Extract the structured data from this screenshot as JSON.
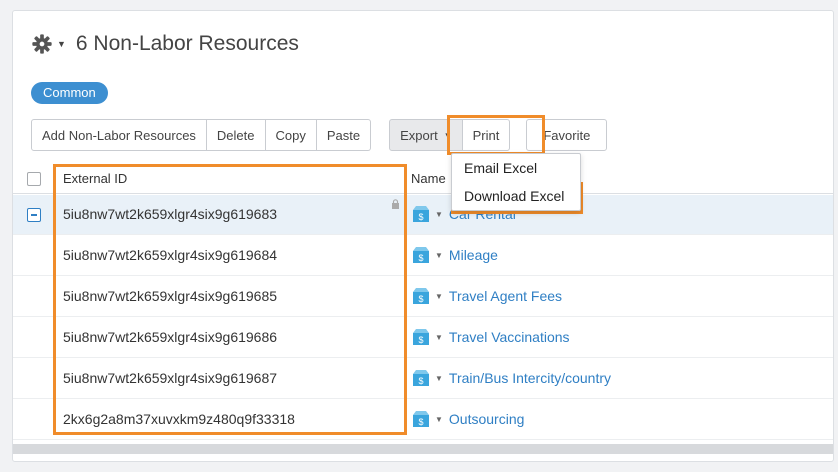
{
  "header": {
    "title": "6 Non-Labor Resources",
    "gear_icon": "gear-icon",
    "menu_caret": "chevron-down-icon"
  },
  "tag": {
    "label": "Common",
    "color": "#3d8fd1"
  },
  "toolbar": {
    "add_label": "Add Non-Labor Resources",
    "delete_label": "Delete",
    "copy_label": "Copy",
    "paste_label": "Paste",
    "export_label": "Export",
    "print_label": "Print",
    "favorite_label": "Favorite"
  },
  "export_menu": {
    "items": [
      "Email Excel",
      "Download Excel"
    ]
  },
  "table": {
    "columns": [
      "External ID",
      "Name"
    ],
    "rows": [
      {
        "id": "5iu8nw7wt2k659xlgr4six9g619683",
        "name": "Car Rental",
        "selected": true
      },
      {
        "id": "5iu8nw7wt2k659xlgr4six9g619684",
        "name": "Mileage"
      },
      {
        "id": "5iu8nw7wt2k659xlgr4six9g619685",
        "name": "Travel Agent Fees"
      },
      {
        "id": "5iu8nw7wt2k659xlgr4six9g619686",
        "name": "Travel Vaccinations"
      },
      {
        "id": "5iu8nw7wt2k659xlgr4six9g619687",
        "name": "Train/Bus Intercity/country"
      },
      {
        "id": "2kx6g2a8m37xuvxkm9z480q9f33318",
        "name": "Outsourcing"
      }
    ]
  },
  "colors": {
    "accent": "#2f7fc4",
    "highlight": "#f08c2a"
  }
}
